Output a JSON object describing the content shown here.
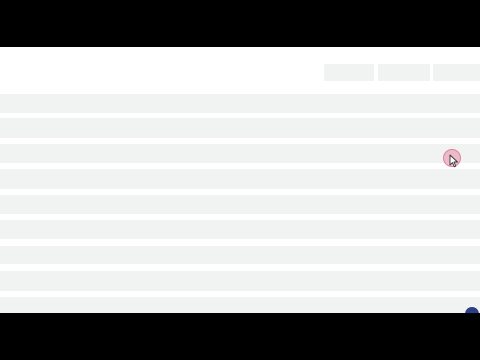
{
  "toolbar": {
    "buttons": [
      "",
      "",
      ""
    ]
  },
  "table": {
    "rows": [
      "",
      "",
      "",
      "",
      "",
      "",
      "",
      "",
      ""
    ]
  },
  "colors": {
    "row_background": "#f1f2f2",
    "page_background": "#ffffff",
    "cursor_highlight": "#e88ca5",
    "badge": "#2b3f86"
  },
  "icons": {
    "cursor": "mouse-pointer-icon",
    "badge": "help-bubble-icon"
  }
}
